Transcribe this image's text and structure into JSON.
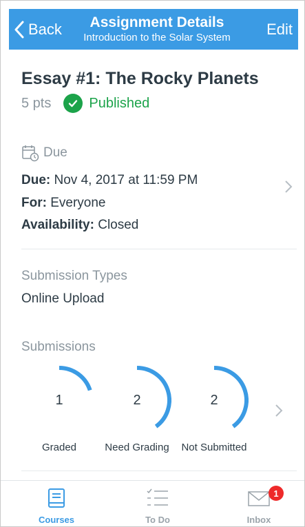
{
  "colors": {
    "accent": "#3b9be4",
    "published": "#1ca34a",
    "muted": "#8b969e",
    "text": "#2d3b45",
    "badge": "#ee2a2a"
  },
  "header": {
    "back_label": "Back",
    "title": "Assignment Details",
    "subtitle": "Introduction to the Solar System",
    "edit_label": "Edit"
  },
  "assignment": {
    "title": "Essay #1: The Rocky Planets",
    "points": "5 pts",
    "status": "Published"
  },
  "due": {
    "heading": "Due",
    "due_label": "Due:",
    "due_value": "Nov 4, 2017 at 11:59 PM",
    "for_label": "For:",
    "for_value": "Everyone",
    "availability_label": "Availability:",
    "availability_value": "Closed"
  },
  "submission_types": {
    "heading": "Submission Types",
    "value": "Online Upload"
  },
  "submissions": {
    "heading": "Submissions",
    "stats": [
      {
        "count": "1",
        "label": "Graded",
        "fraction": 0.2
      },
      {
        "count": "2",
        "label": "Need Grading",
        "fraction": 0.4
      },
      {
        "count": "2",
        "label": "Not Submitted",
        "fraction": 0.4
      }
    ]
  },
  "tabbar": {
    "tabs": [
      {
        "label": "Courses",
        "icon": "book-icon",
        "active": true
      },
      {
        "label": "To Do",
        "icon": "checklist-icon",
        "active": false
      },
      {
        "label": "Inbox",
        "icon": "envelope-icon",
        "active": false,
        "badge": "1"
      }
    ]
  }
}
